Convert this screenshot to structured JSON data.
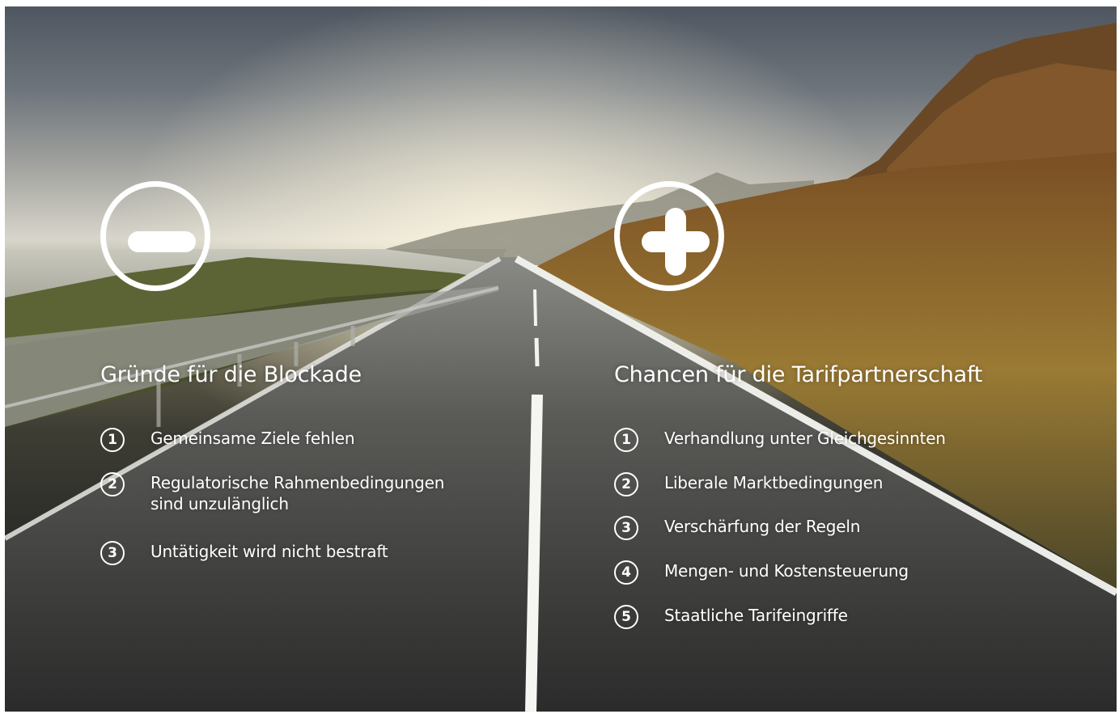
{
  "left_panel": {
    "icon": "minus-circle-icon",
    "heading": "Gründe für die Blockade",
    "items": [
      {
        "num": "1",
        "text": "Gemeinsame Ziele fehlen"
      },
      {
        "num": "2",
        "text_line1": "Regulatorische Rahmenbedingungen",
        "text_line2": "sind unzulänglich"
      },
      {
        "num": "3",
        "text": "Untätigkeit wird nicht bestraft"
      }
    ]
  },
  "right_panel": {
    "icon": "plus-circle-icon",
    "heading": "Chancen für die Tarifpartnerschaft",
    "items": [
      {
        "num": "1",
        "text": "Verhandlung unter Gleichgesinnten"
      },
      {
        "num": "2",
        "text": "Liberale Marktbedingungen"
      },
      {
        "num": "3",
        "text": "Verschärfung der Regeln"
      },
      {
        "num": "4",
        "text": "Mengen- und Kostensteuerung"
      },
      {
        "num": "5",
        "text": "Staatliche Tarifeingriffe"
      }
    ]
  },
  "colors": {
    "foreground": "#ffffff",
    "sky": "#a9a9a4",
    "road": "#262725",
    "hills": "#8a6a2a"
  }
}
